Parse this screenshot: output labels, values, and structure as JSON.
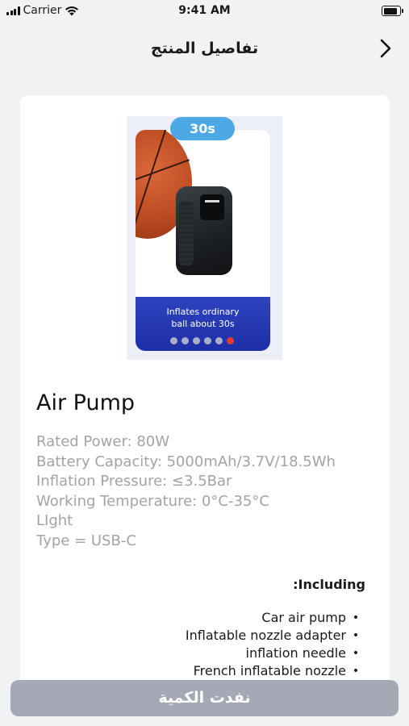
{
  "status_bar": {
    "carrier": "Carrier",
    "time": "9:41 AM",
    "battery_level": 1.0
  },
  "nav": {
    "title": "تفاصيل المنتج",
    "back_icon": "chevron-right-icon"
  },
  "product": {
    "image": {
      "time_badge": "30s",
      "banner_line1": "Inflates ordinary",
      "banner_line2": "ball about 30s",
      "carousel_total": 6,
      "carousel_active_index": 5
    },
    "name": "Air Pump",
    "specs": [
      "Rated Power: 80W",
      "Battery Capacity: 5000mAh/3.7V/18.5Wh",
      "Inflation Pressure: ≤3.5Bar",
      "Working Temperature: 0°C-35°C",
      "LIght",
      "Type = USB-C"
    ],
    "including_title": "Including:",
    "including_items": [
      "Car air pump",
      "Inflatable nozzle adapter",
      "inflation needle",
      "French inflatable nozzle"
    ]
  },
  "cta": {
    "label": "نفدت الكمية"
  },
  "colors": {
    "accent_blue": "#4da8e6",
    "banner_blue": "#2f43c0",
    "active_dot": "#e73a2a",
    "disabled_button": "#a5a9b5"
  }
}
